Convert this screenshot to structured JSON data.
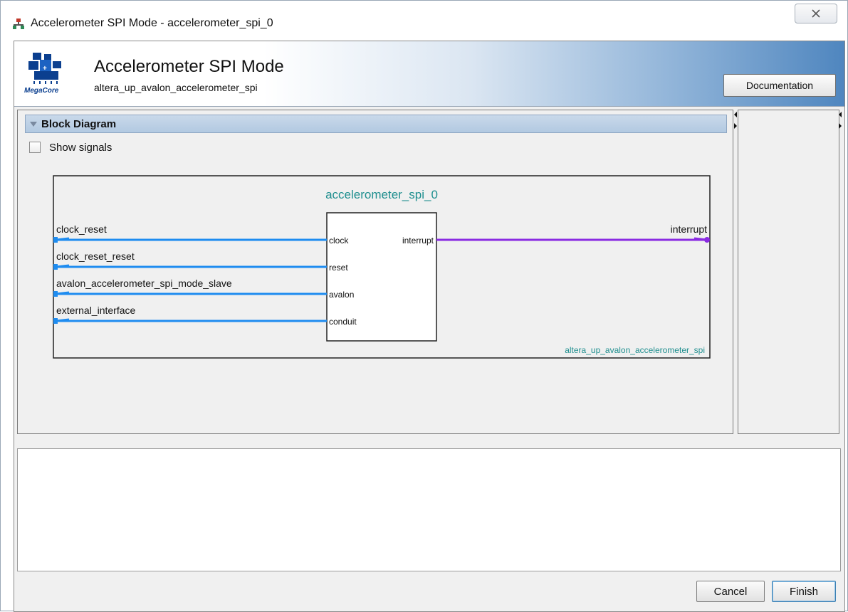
{
  "window": {
    "title": "Accelerometer SPI Mode - accelerometer_spi_0",
    "close_icon": "close-icon"
  },
  "header": {
    "logo_text": "MegaCore",
    "title": "Accelerometer SPI Mode",
    "subtitle": "altera_up_avalon_accelerometer_spi",
    "documentation_label": "Documentation"
  },
  "block_diagram": {
    "section_label": "Block Diagram",
    "show_signals_label": "Show signals",
    "show_signals_checked": false,
    "instance_name": "accelerometer_spi_0",
    "component_name": "altera_up_avalon_accelerometer_spi",
    "inputs": [
      {
        "external": "clock_reset",
        "port": "clock"
      },
      {
        "external": "clock_reset_reset",
        "port": "reset"
      },
      {
        "external": "avalon_accelerometer_spi_mode_slave",
        "port": "avalon"
      },
      {
        "external": "external_interface",
        "port": "conduit"
      }
    ],
    "outputs": [
      {
        "external": "interrupt",
        "port": "interrupt"
      }
    ],
    "colors": {
      "input_wire": "#1e8cf0",
      "output_wire": "#8a2be2",
      "instance_text": "#1f8f8f"
    }
  },
  "footer": {
    "cancel_label": "Cancel",
    "finish_label": "Finish"
  }
}
